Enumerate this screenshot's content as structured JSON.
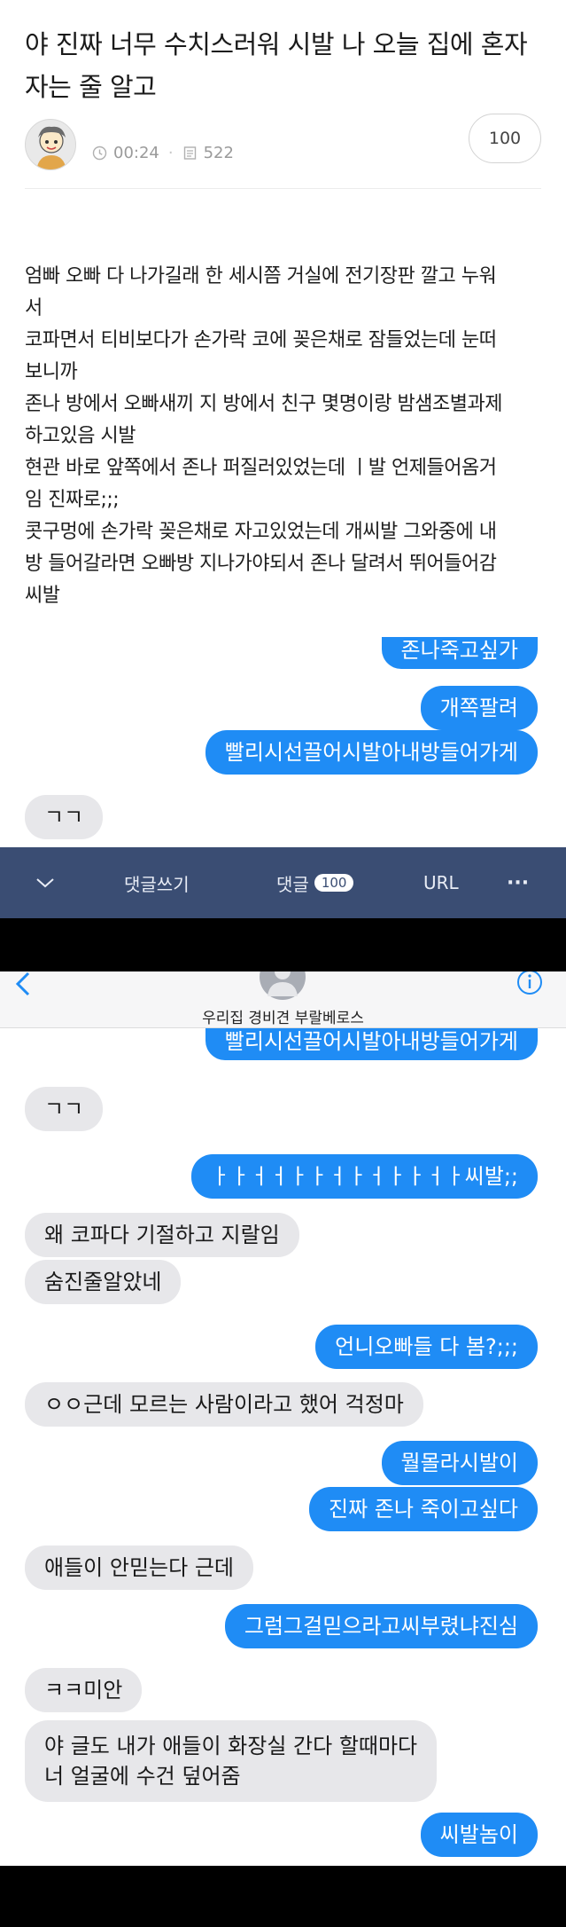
{
  "post": {
    "title_lines": [
      "야 진짜 너무 수치스러워 시발 나 오늘 집에 혼자",
      "자는 줄 알고"
    ],
    "time": "00:24",
    "views": "522",
    "score": "100",
    "body_lines": [
      "엄빠 오빠 다 나가길래 한 세시쯤 거실에 전기장판 깔고 누워",
      "서",
      "코파면서 티비보다가 손가락 코에 꽂은채로 잠들었는데 눈떠",
      "보니까",
      "존나 방에서 오빠새끼 지 방에서 친구 몇명이랑 밤샘조별과제",
      "하고있음 시발",
      "현관 바로 앞쪽에서 존나 퍼질러있었는데 ㅣ발 언제들어옴거",
      "임 진짜로;;;",
      "콧구멍에 손가락 꽂은채로 자고있었는데 개씨발 그와중에 내",
      "방 들어갈라면 오빠방 지나가야되서 존나 달려서 뛰어들어감",
      "씨발"
    ],
    "messages": [
      {
        "dir": "out",
        "text": "존나죽고싶가"
      },
      {
        "dir": "out",
        "text": "개쪽팔려"
      },
      {
        "dir": "out",
        "text": "빨리시선끌어시발아내방들어가게"
      },
      {
        "dir": "in",
        "text": "ㄱㄱ"
      }
    ]
  },
  "bottombar": {
    "write_label": "댓글쓰기",
    "comments_label": "댓글",
    "comments_count": "100",
    "url_label": "URL",
    "more_label": "···"
  },
  "chat": {
    "contact_name": "우리집 경비견 부랄베로스",
    "messages": [
      {
        "dir": "out",
        "text": "빨리시선끌어시발아내방들어가게"
      },
      {
        "dir": "in",
        "text": "ㄱㄱ"
      },
      {
        "dir": "out",
        "text": "ㅏㅏㅓㅓㅏㅏㅓㅏㅓㅏㅏㅓㅏ씨발;;"
      },
      {
        "dir": "in",
        "text": "왜 코파다 기절하고 지랄임"
      },
      {
        "dir": "in",
        "text": "숨진줄알았네"
      },
      {
        "dir": "out",
        "text": "언니오빠들 다 봄?;;;"
      },
      {
        "dir": "in",
        "text": "ㅇㅇ근데 모르는 사람이라고 했어 걱정마"
      },
      {
        "dir": "out",
        "text": "뭘몰라시발이"
      },
      {
        "dir": "out",
        "text": "진짜 존나 죽이고싶다"
      },
      {
        "dir": "in",
        "text": "애들이 안믿는다 근데"
      },
      {
        "dir": "out",
        "text": "그럼그걸믿으라고씨부렸냐진심"
      },
      {
        "dir": "in",
        "text": "ㅋㅋ미안"
      },
      {
        "dir": "in",
        "text": "야 글도 내가 애들이 화장실 간다 할때마다",
        "text2": "너 얼굴에 수건 덮어줌"
      },
      {
        "dir": "out",
        "text": "씨발놈이"
      }
    ]
  },
  "colors": {
    "outgoing": "#1f8cf5",
    "incoming": "#e7e7ea",
    "bottombar": "#3a4d73"
  }
}
